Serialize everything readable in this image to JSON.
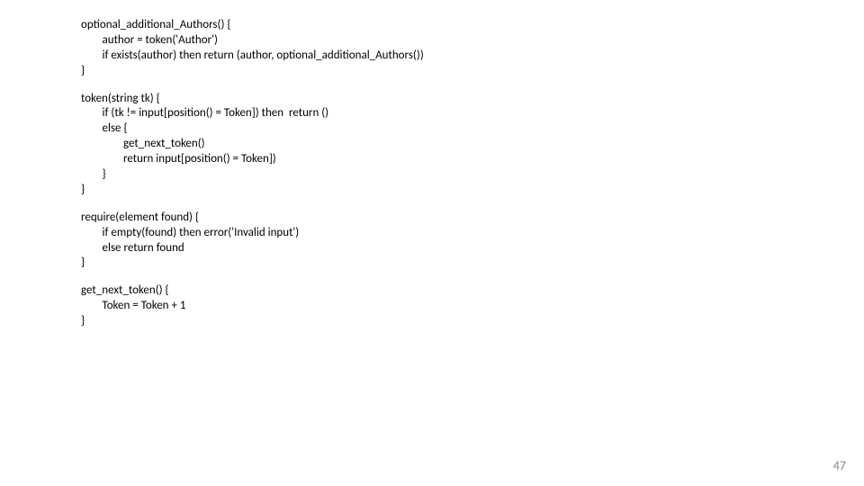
{
  "code": {
    "block1": {
      "l1": "optional_additional_Authors() {",
      "l2": "        author = token('Author')",
      "l3": "        if exists(author) then return (author, optional_additional_Authors())",
      "l4": "}"
    },
    "block2": {
      "l1": "token(string tk) {",
      "l2": "        if (tk != input[position() = Token]) then  return ()",
      "l3": "        else {",
      "l4": "                get_next_token()",
      "l5": "                return input[position() = Token])",
      "l6": "        }",
      "l7": "}"
    },
    "block3": {
      "l1": "require(element found) {",
      "l2": "        if empty(found) then error('Invalid input')",
      "l3": "        else return found",
      "l4": "}"
    },
    "block4": {
      "l1": "get_next_token() {",
      "l2": "        Token = Token + 1",
      "l3": "}"
    }
  },
  "page_number": "47"
}
